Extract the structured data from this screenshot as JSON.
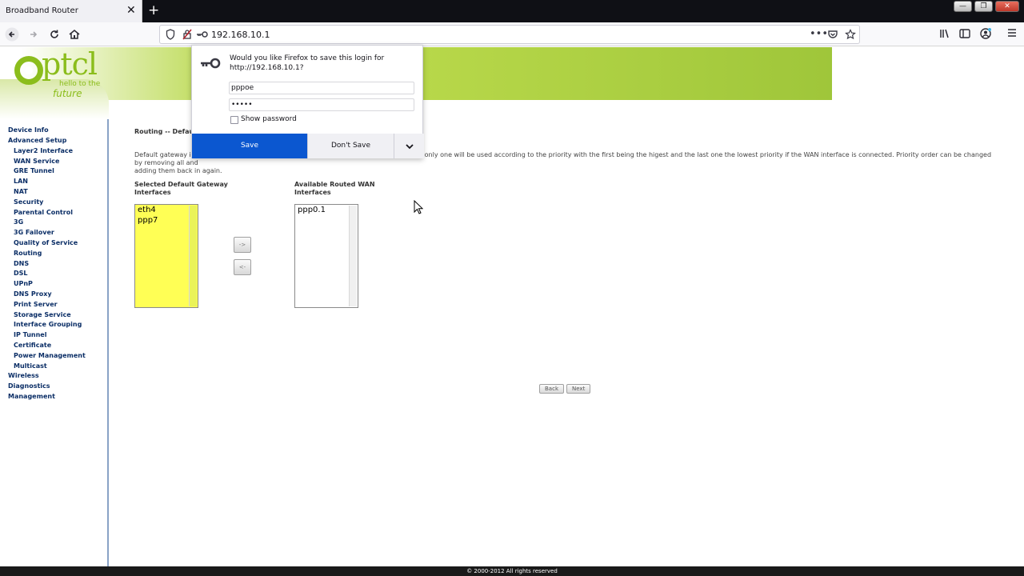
{
  "browser": {
    "tab_title": "Broadband Router",
    "tab_close": "✕",
    "new_tab": "+",
    "url": "192.168.10.1",
    "window_buttons": [
      "—",
      "❐",
      "✕"
    ]
  },
  "logo": {
    "text": "ptcl",
    "tagline": "hello to the",
    "tagline2": "future"
  },
  "sidebar": {
    "items": [
      {
        "label": "Device Info",
        "level": 0
      },
      {
        "label": "Advanced Setup",
        "level": 0
      },
      {
        "label": "Layer2 Interface",
        "level": 1
      },
      {
        "label": "WAN Service",
        "level": 1
      },
      {
        "label": "GRE Tunnel",
        "level": 1
      },
      {
        "label": "LAN",
        "level": 1
      },
      {
        "label": "NAT",
        "level": 1
      },
      {
        "label": "Security",
        "level": 1
      },
      {
        "label": "Parental Control",
        "level": 1
      },
      {
        "label": "3G",
        "level": 1
      },
      {
        "label": "3G Failover",
        "level": 1
      },
      {
        "label": "Quality of Service",
        "level": 1
      },
      {
        "label": "Routing",
        "level": 1
      },
      {
        "label": "DNS",
        "level": 1
      },
      {
        "label": "DSL",
        "level": 1
      },
      {
        "label": "UPnP",
        "level": 1
      },
      {
        "label": "DNS Proxy",
        "level": 1
      },
      {
        "label": "Print Server",
        "level": 1
      },
      {
        "label": "Storage Service",
        "level": 1
      },
      {
        "label": "Interface Grouping",
        "level": 1
      },
      {
        "label": "IP Tunnel",
        "level": 1
      },
      {
        "label": "Certificate",
        "level": 1
      },
      {
        "label": "Power Management",
        "level": 1
      },
      {
        "label": "Multicast",
        "level": 1
      },
      {
        "label": "Wireless",
        "level": 0
      },
      {
        "label": "Diagnostics",
        "level": 0
      },
      {
        "label": "Management",
        "level": 0
      }
    ]
  },
  "main": {
    "section_title": "Routing -- Default",
    "description_line1": "Default gateway inte",
    "description_line1b": "t only one will be used according to the priority with the first being the higest and the last one the lowest priority if the WAN interface is connected. Priority order can be changed by removing all and",
    "description_line2": "adding them back in again.",
    "selected_label": "Selected Default Gateway Interfaces",
    "available_label": "Available Routed WAN Interfaces",
    "selected_items": [
      "eth4",
      "ppp7"
    ],
    "available_items": [
      "ppp0.1"
    ],
    "move_right": "->",
    "move_left": "<-",
    "back_label": "Back",
    "next_label": "Next"
  },
  "footer": {
    "text": "© 2000-2012 All rights reserved"
  },
  "popup": {
    "message": "Would you like Firefox to save this login for http://192.168.10.1?",
    "username": "pppoe",
    "password": "•••••",
    "show_password_label": "Show password",
    "save_label": "Save",
    "dont_save_label": "Don't Save",
    "more_label": "⌄"
  },
  "colors": {
    "accent_green": "#8bbd1c",
    "menu_blue": "#0b2e66",
    "save_blue": "#0b57d0",
    "list_yellow": "#ffff55"
  }
}
